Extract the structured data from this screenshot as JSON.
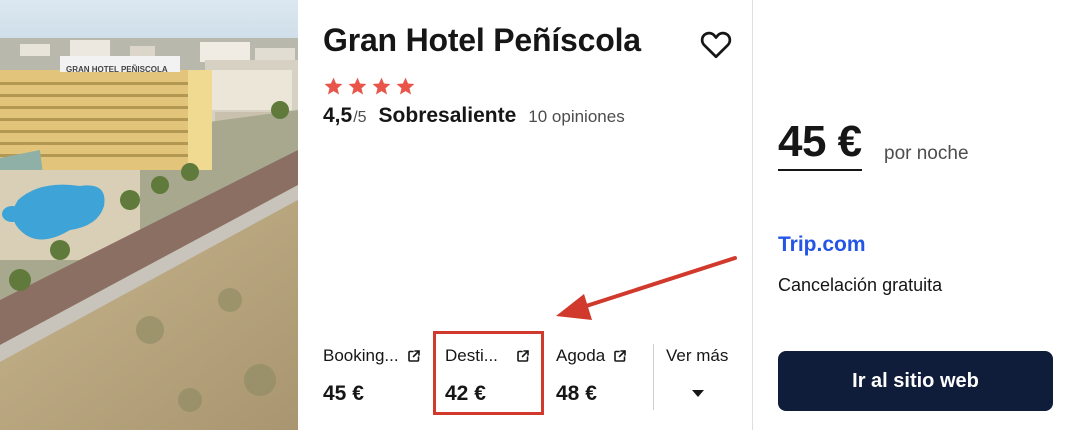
{
  "hotel": {
    "name": "Gran Hotel Peñíscola",
    "star_count": 4,
    "star_color": "#e8554a",
    "photo_sign": "GRAN HOTEL PEÑISCOLA"
  },
  "rating": {
    "score": "4,5",
    "max": "/5",
    "label": "Sobresaliente",
    "reviews": "10 opiniones"
  },
  "providers": [
    {
      "name": "Booking...",
      "price": "45 €",
      "icon": "external-link-icon"
    },
    {
      "name": "Desti...",
      "price": "42 €",
      "icon": "external-link-icon"
    },
    {
      "name": "Agoda",
      "price": "48 €",
      "icon": "external-link-icon"
    }
  ],
  "more": {
    "label": "Ver más",
    "icon": "caret-down-icon"
  },
  "offer": {
    "price": "45 €",
    "per_night": "por noche",
    "site": "Trip.com",
    "cancellation": "Cancelación gratuita",
    "cta": "Ir al sitio web"
  },
  "annotation": {
    "color": "#d0392b"
  },
  "colors": {
    "accent": "#2356e6",
    "cta_bg": "#101d3a"
  }
}
